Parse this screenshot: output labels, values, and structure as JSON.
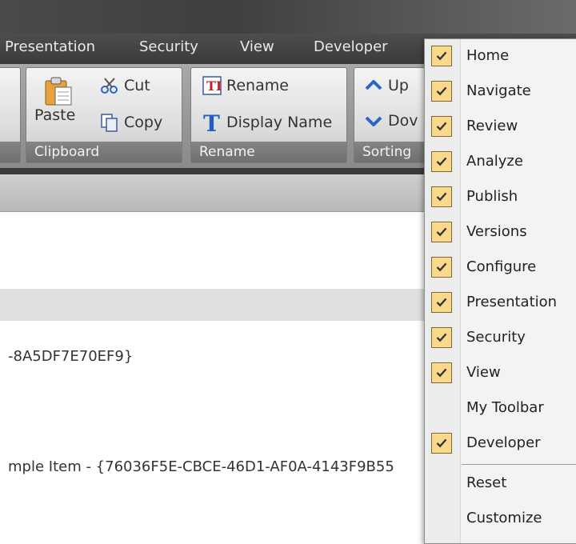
{
  "tabs": [
    "Presentation",
    "Security",
    "View",
    "Developer"
  ],
  "ribbon": {
    "clipboard": {
      "paste": "Paste",
      "cut": "Cut",
      "copy": "Copy",
      "label": "Clipboard"
    },
    "rename": {
      "rename": "Rename",
      "display_name": "Display Name",
      "label": "Rename"
    },
    "sorting": {
      "up": "Up",
      "down": "Dov",
      "label": "Sorting"
    }
  },
  "content": {
    "line1": "-8A5DF7E70EF9}",
    "line2": "mple Item - {76036F5E-CBCE-46D1-AF0A-4143F9B55"
  },
  "menu": {
    "items": [
      {
        "label": "Home",
        "checked": true
      },
      {
        "label": "Navigate",
        "checked": true
      },
      {
        "label": "Review",
        "checked": true
      },
      {
        "label": "Analyze",
        "checked": true
      },
      {
        "label": "Publish",
        "checked": true
      },
      {
        "label": "Versions",
        "checked": true
      },
      {
        "label": "Configure",
        "checked": true
      },
      {
        "label": "Presentation",
        "checked": true
      },
      {
        "label": "Security",
        "checked": true
      },
      {
        "label": "View",
        "checked": true
      },
      {
        "label": "My Toolbar",
        "checked": false
      },
      {
        "label": "Developer",
        "checked": true
      }
    ],
    "reset": "Reset",
    "customize": "Customize"
  }
}
